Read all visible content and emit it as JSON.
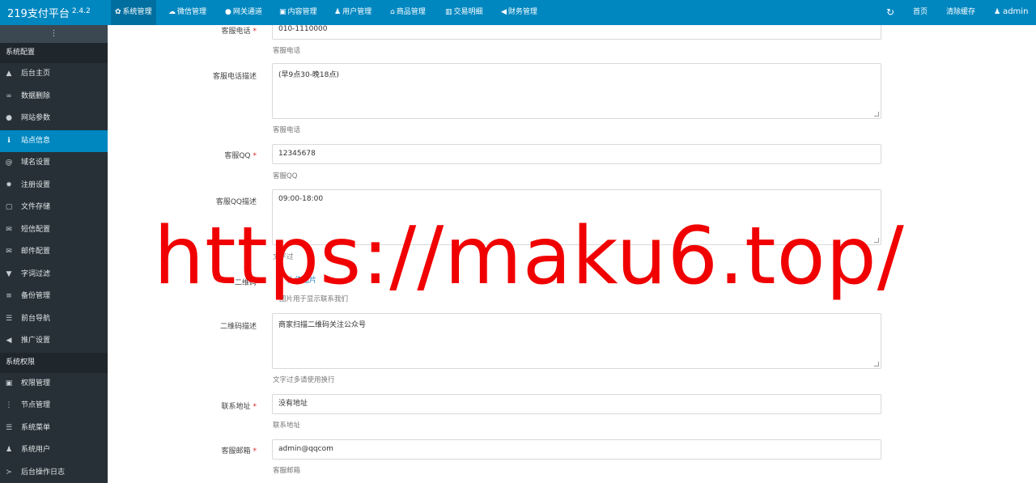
{
  "brand": {
    "name": "219支付平台",
    "version": "2.4.2"
  },
  "top_menu": [
    {
      "icon": "gear-icon",
      "glyph": "✿",
      "label": "系统管理",
      "active": true
    },
    {
      "icon": "wechat-icon",
      "glyph": "☁",
      "label": "微信管理",
      "active": false
    },
    {
      "icon": "gateway-icon",
      "glyph": "●",
      "label": "网关通道",
      "active": false
    },
    {
      "icon": "content-icon",
      "glyph": "▣",
      "label": "内容管理",
      "active": false
    },
    {
      "icon": "users-icon",
      "glyph": "♟",
      "label": "用户管理",
      "active": false
    },
    {
      "icon": "store-icon",
      "glyph": "⌂",
      "label": "商品管理",
      "active": false
    },
    {
      "icon": "bar-chart-icon",
      "glyph": "▥",
      "label": "交易明细",
      "active": false
    },
    {
      "icon": "megaphone-icon",
      "glyph": "◀",
      "label": "财务管理",
      "active": false
    }
  ],
  "top_right": {
    "refresh_glyph": "↻",
    "home": "首页",
    "clear_cache": "清除缓存",
    "user": "admin",
    "user_glyph": "♟"
  },
  "sidebar": {
    "toggle_glyph": "⋮",
    "groups": [
      {
        "title": "系统配置",
        "items": [
          {
            "icon": "area-chart-icon",
            "glyph": "▲",
            "label": "后台主页"
          },
          {
            "icon": "link-icon",
            "glyph": "∞",
            "label": "数据删除"
          },
          {
            "icon": "apple-icon",
            "glyph": "●",
            "label": "网站参数"
          },
          {
            "icon": "info-icon",
            "glyph": "ℹ",
            "label": "站点信息",
            "active": true
          },
          {
            "icon": "at-icon",
            "glyph": "@",
            "label": "域名设置"
          },
          {
            "icon": "cog-icon",
            "glyph": "✹",
            "label": "注册设置"
          },
          {
            "icon": "save-icon",
            "glyph": "▢",
            "label": "文件存储"
          },
          {
            "icon": "envelope-icon",
            "glyph": "✉",
            "label": "短信配置"
          },
          {
            "icon": "envelope-icon",
            "glyph": "✉",
            "label": "邮件配置"
          },
          {
            "icon": "filter-icon",
            "glyph": "▼",
            "label": "字词过滤"
          },
          {
            "icon": "database-icon",
            "glyph": "≡",
            "label": "备份管理"
          },
          {
            "icon": "menu-icon",
            "glyph": "☰",
            "label": "前台导航"
          },
          {
            "icon": "bullhorn-icon",
            "glyph": "◀",
            "label": "推广设置"
          }
        ]
      },
      {
        "title": "系统权限",
        "items": [
          {
            "icon": "lock-icon",
            "glyph": "▣",
            "label": "权限管理"
          },
          {
            "icon": "dots-icon",
            "glyph": "⋮",
            "label": "节点管理"
          },
          {
            "icon": "list-icon",
            "glyph": "☰",
            "label": "系统菜单"
          },
          {
            "icon": "users-icon",
            "glyph": "♟",
            "label": "系统用户"
          },
          {
            "icon": "terminal-icon",
            "glyph": "≻",
            "label": "后台操作日志"
          }
        ]
      }
    ]
  },
  "form": {
    "phone": {
      "label": "客服电话",
      "value": "010-1110000",
      "help": "客服电话"
    },
    "phone_desc": {
      "label": "客服电话描述",
      "value": "(早9点30-晚18点)",
      "help": "客服电话"
    },
    "qq": {
      "label": "客服QQ",
      "value": "12345678",
      "help": "客服QQ"
    },
    "qq_desc": {
      "label": "客服QQ描述",
      "value": "09:00-18:00",
      "help": "文字过"
    },
    "qrcode": {
      "label": "二维码",
      "upload": "上传图片",
      "help": "图片用于显示联系我们"
    },
    "qrcode_desc": {
      "label": "二维码描述",
      "value": "商家扫描二维码关注公众号",
      "help": "文字过多请使用换行"
    },
    "address": {
      "label": "联系地址",
      "value": "没有地址",
      "help": "联系地址"
    },
    "email": {
      "label": "客服邮箱",
      "value": "admin@qqcom",
      "help": "客服邮箱"
    }
  },
  "watermark": "https://maku6.top/"
}
